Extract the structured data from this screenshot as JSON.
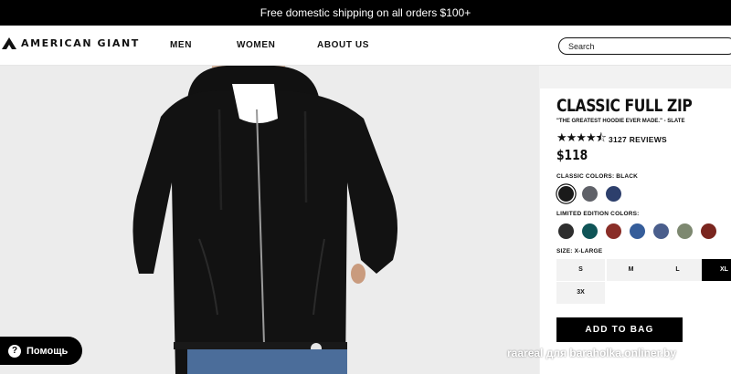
{
  "promo": {
    "text": "Free domestic shipping on all orders $100+"
  },
  "header": {
    "brand": "AMERICAN GIANT",
    "nav": [
      "MEN",
      "WOMEN",
      "ABOUT US"
    ],
    "search_placeholder": "Search"
  },
  "product": {
    "title": "CLASSIC FULL ZIP",
    "subtitle": "\"THE GREATEST HOODIE EVER MADE.\" - SLATE",
    "rating_stars": 4.5,
    "stars_glyph": "★★★★⯪",
    "reviews": "3127 REVIEWS",
    "price": "$118",
    "classic_label": "CLASSIC COLORS: BLACK",
    "classic_colors": [
      "#1a1a1a",
      "#5f6168",
      "#2d3f6c"
    ],
    "limited_label": "LIMITED EDITION COLORS:",
    "limited_colors": [
      "#2e2e2e",
      "#0f5457",
      "#8a2e28",
      "#355d9a",
      "#4a5e8c",
      "#7d8870",
      "#7a261f"
    ],
    "size_label": "SIZE: X-LARGE",
    "sizes": [
      "S",
      "M",
      "L",
      "XL",
      "3X"
    ],
    "selected_size": "XL",
    "add_to_bag": "ADD TO BAG"
  },
  "help": {
    "label": "Помощь",
    "icon": "question-icon"
  },
  "watermark": "raareal для baraholka.onliner.by",
  "colors": {
    "accent": "#000000",
    "background": "#f2f2f2"
  }
}
